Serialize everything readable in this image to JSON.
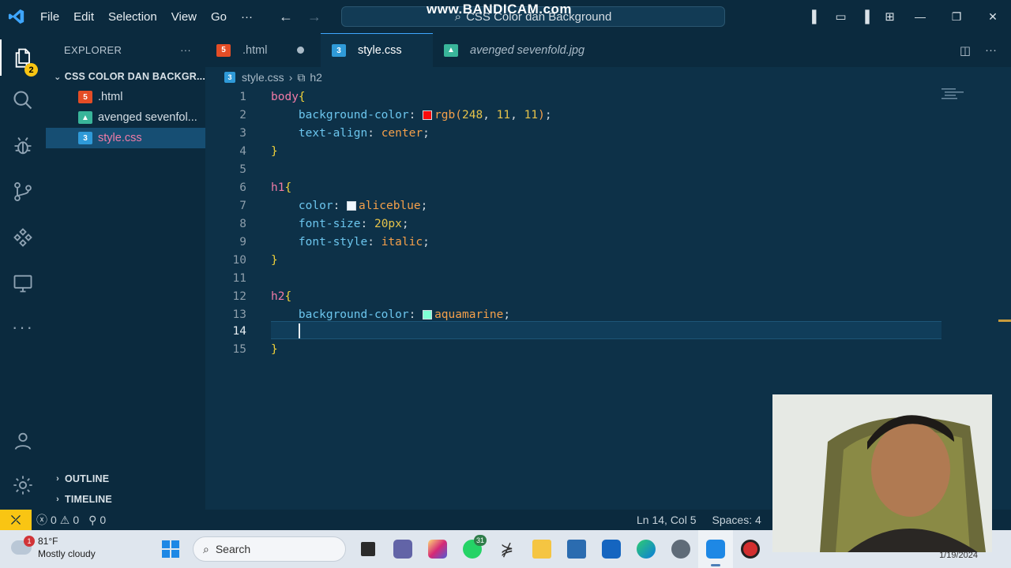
{
  "titlebar": {
    "menu": [
      "File",
      "Edit",
      "Selection",
      "View",
      "Go",
      "···"
    ],
    "search_text": "CSS Color dan Background",
    "watermark": "www.BANDICAM.com"
  },
  "activitybar": {
    "explorer_badge": "2"
  },
  "sidebar": {
    "header": "EXPLORER",
    "more": "···",
    "folder": "CSS COLOR DAN BACKGR...",
    "files": [
      {
        "name": ".html",
        "type": "html"
      },
      {
        "name": "avenged sevenfol...",
        "type": "img"
      },
      {
        "name": "style.css",
        "type": "css"
      }
    ],
    "outline": "OUTLINE",
    "timeline": "TIMELINE"
  },
  "tabs": [
    {
      "label": ".html",
      "type": "html",
      "dirty": true,
      "active": false,
      "italic": false
    },
    {
      "label": "style.css",
      "type": "css",
      "dirty": true,
      "active": true,
      "italic": false
    },
    {
      "label": "avenged sevenfold.jpg",
      "type": "img",
      "dirty": false,
      "active": false,
      "italic": true
    }
  ],
  "breadcrumb": {
    "file": "style.css",
    "symbol": "h2"
  },
  "editor": {
    "current_line": 14,
    "lines": [
      {
        "n": "1"
      },
      {
        "n": "2"
      },
      {
        "n": "3"
      },
      {
        "n": "4"
      },
      {
        "n": "5"
      },
      {
        "n": "6"
      },
      {
        "n": "7"
      },
      {
        "n": "8"
      },
      {
        "n": "9"
      },
      {
        "n": "10"
      },
      {
        "n": "11"
      },
      {
        "n": "12"
      },
      {
        "n": "13"
      },
      {
        "n": "14"
      },
      {
        "n": "15"
      }
    ],
    "tokens": {
      "body": "body",
      "bg_prop": "background-color",
      "rgb_fn": "rgb(",
      "r": "248",
      "g": "11",
      "b": "11",
      "ta_prop": "text-align",
      "center": "center",
      "h1": "h1",
      "color_prop": "color",
      "aliceblue": "aliceblue",
      "fs_prop": "font-size",
      "fs_val": "20px",
      "fst_prop": "font-style",
      "italic": "italic",
      "h2": "h2",
      "aquamarine": "aquamarine"
    },
    "swatch_colors": {
      "red": "#f80b0b",
      "aliceblue": "#f0f8ff",
      "aquamarine": "#7fffd4"
    }
  },
  "statusbar": {
    "errors": "0",
    "warnings": "0",
    "ports": "0",
    "position": "Ln 14, Col 5",
    "spaces": "Spaces: 4"
  },
  "taskbar": {
    "weather_temp": "81°F",
    "weather_desc": "Mostly cloudy",
    "weather_badge": "1",
    "search_placeholder": "Search",
    "whatsapp_badge": "31",
    "date": "1/19/2024"
  },
  "colors": {
    "editor_bg": "#0d3148",
    "chrome_bg": "#0b2a3e",
    "accent": "#3ea6ff",
    "remote": "#f9c513"
  }
}
